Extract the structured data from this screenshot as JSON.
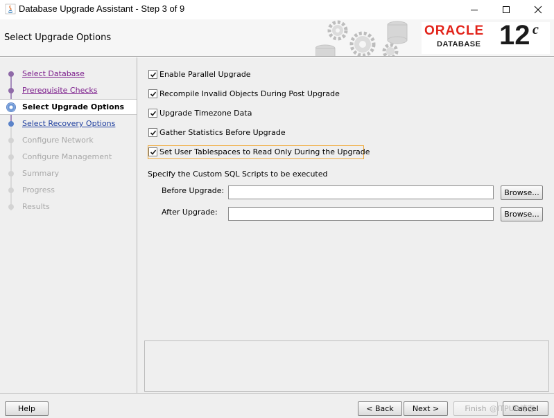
{
  "window": {
    "title": "Database Upgrade Assistant - Step 3 of 9"
  },
  "header": {
    "title": "Select Upgrade Options",
    "logo": {
      "brand": "ORACLE",
      "product": "DATABASE",
      "version": "12",
      "version_suffix": "c"
    }
  },
  "sidebar": {
    "steps": [
      {
        "label": "Select Database",
        "state": "done"
      },
      {
        "label": "Prerequisite Checks",
        "state": "done"
      },
      {
        "label": "Select Upgrade Options",
        "state": "current"
      },
      {
        "label": "Select Recovery Options",
        "state": "link"
      },
      {
        "label": "Configure Network",
        "state": "disabled"
      },
      {
        "label": "Configure Management",
        "state": "disabled"
      },
      {
        "label": "Summary",
        "state": "disabled"
      },
      {
        "label": "Progress",
        "state": "disabled"
      },
      {
        "label": "Results",
        "state": "disabled"
      }
    ]
  },
  "options": [
    {
      "label": "Enable Parallel Upgrade",
      "checked": true
    },
    {
      "label": "Recompile Invalid Objects During Post Upgrade",
      "checked": true
    },
    {
      "label": "Upgrade Timezone Data",
      "checked": true
    },
    {
      "label": "Gather Statistics Before Upgrade",
      "checked": true
    },
    {
      "label": "Set User Tablespaces to Read Only During the Upgrade",
      "checked": true
    }
  ],
  "scripts": {
    "section_label": "Specify the Custom SQL Scripts to be executed",
    "before_label": "Before Upgrade:",
    "before_value": "",
    "after_label": "After Upgrade:",
    "after_value": "",
    "browse_label": "Browse..."
  },
  "footer": {
    "help": "Help",
    "back": "< Back",
    "next": "Next >",
    "finish": "Finish",
    "cancel": "Cancel",
    "watermark": "@ITPUB博客"
  },
  "colors": {
    "oracle_red": "#e2231a",
    "visited_link": "#7a1a8a",
    "link": "#1f3f9f",
    "focus_outline": "#f1a938"
  }
}
